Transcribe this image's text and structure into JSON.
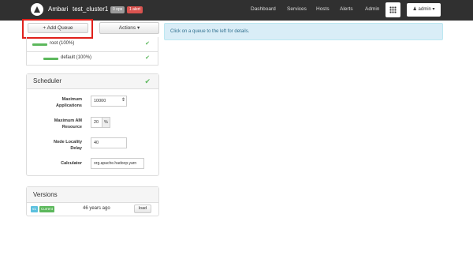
{
  "navbar": {
    "brand": "Ambari",
    "cluster_name": "test_cluster1",
    "ops_badge": "0 ops",
    "alert_badge": "1 alert",
    "links": [
      "Dashboard",
      "Services",
      "Hosts",
      "Alerts",
      "Admin"
    ],
    "user_menu": "admin"
  },
  "toolbar": {
    "add_queue_label": "+ Add Queue",
    "actions_label": "Actions"
  },
  "queues": [
    {
      "label": "root (100%)"
    },
    {
      "label": "default (100%)"
    }
  ],
  "info_message": "Click on a queue to the left for details.",
  "scheduler": {
    "title": "Scheduler",
    "fields": {
      "max_apps": {
        "label_line1": "Maximum",
        "label_line2": "Applications",
        "value": "10000"
      },
      "max_am": {
        "label_line1": "Maximum AM",
        "label_line2": "Resource",
        "value": "20",
        "unit": "%"
      },
      "locality": {
        "label_line1": "Node Locality",
        "label_line2": "Delay",
        "value": "40"
      },
      "calculator": {
        "label": "Calculator",
        "value": "org.apache.hadoop.yarn"
      }
    }
  },
  "versions": {
    "title": "Versions",
    "row": {
      "version_tag": "v1",
      "current_tag": "Current",
      "age": "46 years ago",
      "load_label": "load"
    }
  },
  "colors": {
    "navbar_bg": "#303030",
    "success_green": "#5cb85c",
    "alert_red": "#d9534f",
    "info_bg": "#d9edf7",
    "highlight_red": "#e0201b"
  }
}
